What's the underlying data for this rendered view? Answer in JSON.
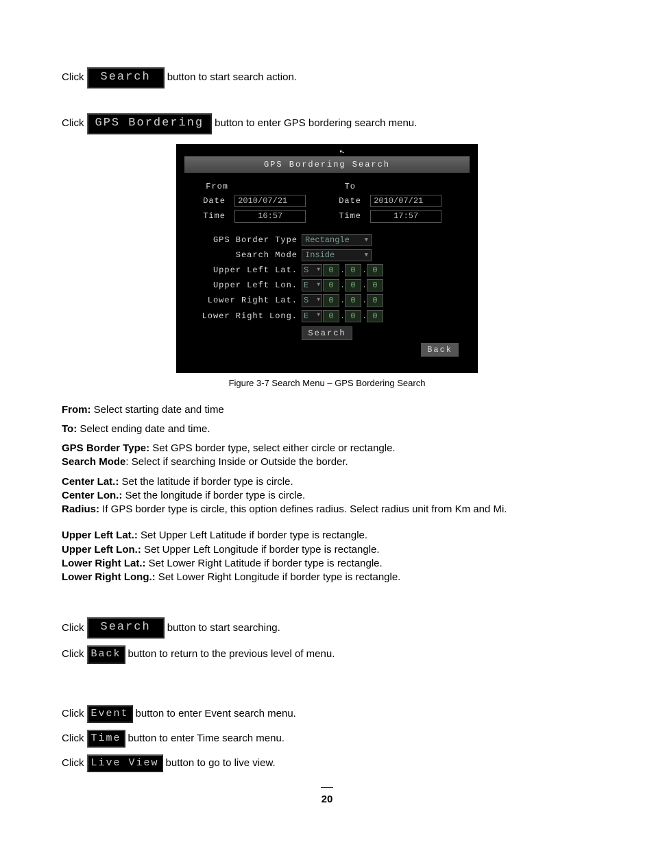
{
  "buttons": {
    "search_wide": "Search",
    "gps_bordering": "GPS Bordering",
    "search_wide2": "Search",
    "back_small": "Back",
    "event_small": "Event",
    "time_small": "Time",
    "live_view": "Live View"
  },
  "intro1": {
    "prefix": "Click",
    "suffix": " button to start search action."
  },
  "intro2": {
    "prefix": "Click",
    "suffix": " button to enter GPS bordering search menu."
  },
  "screenshot": {
    "title": "GPS Bordering Search",
    "from_label": "From",
    "to_label": "To",
    "date_label": "Date",
    "time_label": "Time",
    "from_date": "2010/07/21",
    "from_time": "16:57",
    "to_date": "2010/07/21",
    "to_time": "17:57",
    "border_type_label": "GPS Border Type",
    "border_type_value": "Rectangle",
    "search_mode_label": "Search Mode",
    "search_mode_value": "Inside",
    "rows": {
      "ul_lat": {
        "label": "Upper Left Lat.",
        "dir": "S",
        "a": "0",
        "b": "0",
        "c": "0"
      },
      "ul_lon": {
        "label": "Upper Left Lon.",
        "dir": "E",
        "a": "0",
        "b": "0",
        "c": "0"
      },
      "lr_lat": {
        "label": "Lower Right Lat.",
        "dir": "S",
        "a": "0",
        "b": "0",
        "c": "0"
      },
      "lr_lon": {
        "label": "Lower Right Long.",
        "dir": "E",
        "a": "0",
        "b": "0",
        "c": "0"
      }
    },
    "search_btn": "Search",
    "back_btn": "Back"
  },
  "caption": "Figure 3-7 Search Menu – GPS Bordering Search",
  "desc": {
    "from_b": "From:",
    "from_t": " Select starting date and time",
    "to_b": "To:",
    "to_t": " Select ending date and time.",
    "bt_b": "GPS Border Type:",
    "bt_t": " Set GPS border type, select either circle or rectangle.",
    "sm_b": "Search Mode",
    "sm_t": ": Select if searching Inside or Outside the border.",
    "clat_b": "Center Lat.:",
    "clat_t": " Set the latitude if border type is circle.",
    "clon_b": "Center Lon.:",
    "clon_t": "  Set the longitude if border type is circle.",
    "rad_b": "Radius:",
    "rad_t": " If GPS border type is circle, this option defines radius. Select radius unit from Km and Mi.",
    "ullat_b": "Upper Left Lat.:",
    "ullat_t": " Set Upper Left Latitude if border type is rectangle.",
    "ullon_b": "Upper Left Lon.:",
    "ullon_t": " Set Upper Left Longitude if border type is rectangle.",
    "lrlat_b": "Lower Right Lat.:",
    "lrlat_t": " Set Lower Right Latitude if border type is rectangle.",
    "lrlon_b": "Lower Right Long.:",
    "lrlon_t": " Set Lower Right Longitude if border type is rectangle."
  },
  "clicks": {
    "prefix": "Click",
    "search_t": " button to start searching.",
    "back_t": " button to return to the previous level of menu.",
    "event_t": " button to enter Event search menu.",
    "time_t": " button to enter Time search menu.",
    "live_t": " button to go to live view."
  },
  "page_number": "20"
}
